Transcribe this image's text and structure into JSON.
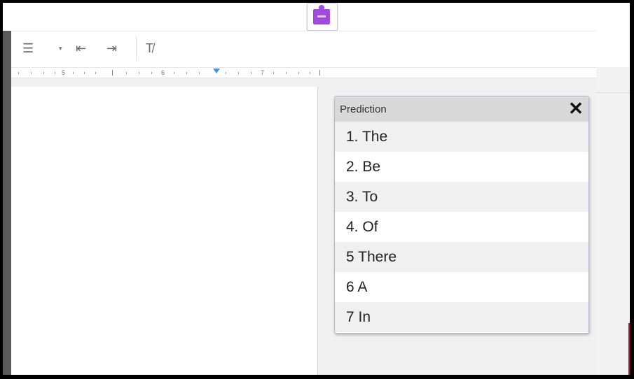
{
  "toolbar": {
    "items": [
      {
        "name": "bulleted-list-dropdown-caret",
        "glyph": "▾"
      },
      {
        "name": "bulleted-list-icon",
        "glyph": "☰"
      },
      {
        "name": "bulleted-list-caret",
        "glyph": "▾"
      },
      {
        "name": "decrease-indent-icon",
        "glyph": "⇤"
      },
      {
        "name": "increase-indent-icon",
        "glyph": "⇥"
      },
      {
        "name": "clear-formatting-icon",
        "glyph": "T̸"
      }
    ]
  },
  "extension": {
    "icon": "puzzle-extension-icon",
    "color": "#a24ae0"
  },
  "ruler": {
    "numbers": [
      "5",
      "6",
      "7"
    ]
  },
  "prediction": {
    "title": "Prediction",
    "close_glyph": "✕",
    "items": [
      "1. The",
      "2. Be",
      "3. To",
      "4. Of",
      "5 There",
      "6 A",
      "7 In"
    ]
  },
  "colors": {
    "accent": "#b3124a",
    "ruler_marker": "#4a8fe0"
  }
}
